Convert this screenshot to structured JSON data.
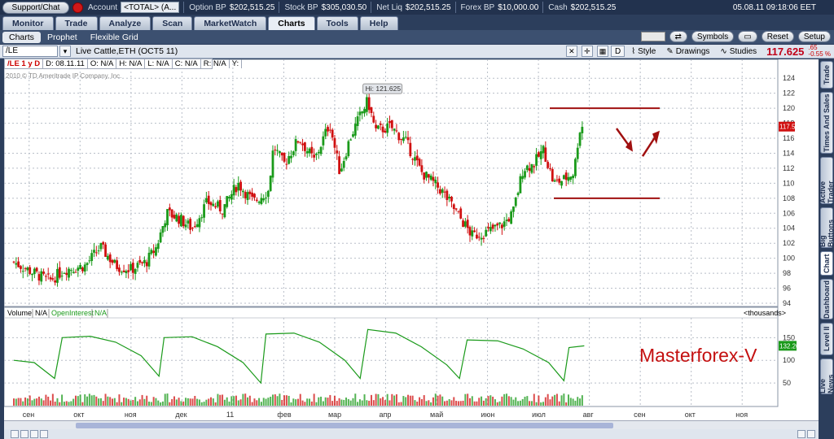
{
  "topbar": {
    "support_label": "Support/Chat",
    "account_label": "Account",
    "account_value": "<TOTAL> (A...",
    "option_bp_label": "Option BP",
    "option_bp_value": "$202,515.25",
    "stock_bp_label": "Stock BP",
    "stock_bp_value": "$305,030.50",
    "net_liq_label": "Net Liq",
    "net_liq_value": "$202,515.25",
    "forex_bp_label": "Forex BP",
    "forex_bp_value": "$10,000.00",
    "cash_label": "Cash",
    "cash_value": "$202,515.25",
    "clock": "05.08.11 09:18:06 EET"
  },
  "main_tabs": [
    "Monitor",
    "Trade",
    "Analyze",
    "Scan",
    "MarketWatch",
    "Charts",
    "Tools",
    "Help"
  ],
  "active_main_tab": "Charts",
  "sub_tabs": [
    "Charts",
    "Prophet",
    "Flexible Grid"
  ],
  "subnav_buttons": {
    "symbols": "Symbols",
    "reset": "Reset",
    "setup": "Setup"
  },
  "symbol_bar": {
    "symbol": "/LE",
    "description": "Live Cattle,ETH (OCT5 11)",
    "period": "D",
    "style": "Style",
    "drawings": "Drawings",
    "studies": "Studies",
    "last_price": "117.625",
    "change": ".65",
    "change_pct": "-0.55 %"
  },
  "info_bar": [
    "/LE 1 y D",
    "D: 08.11.11",
    "O: N/A",
    "H: N/A",
    "L: N/A",
    "C: N/A",
    "R: N/A",
    "Y:"
  ],
  "copyright": "2010 © TD Ameritrade IP Company, Inc.",
  "hi_label": "Hi: 121.625",
  "price_label": "117.55",
  "volume_label": "Volume",
  "na1": "N/A",
  "oi_label": "OpenInterest",
  "na2": "N/A",
  "thousands": "<thousands>",
  "vol_badge": "132.26",
  "watermark": "Masterforex-V",
  "price_axis": [
    "124",
    "122",
    "120",
    "118",
    "116",
    "114",
    "112",
    "110",
    "108",
    "106",
    "104",
    "102",
    "100",
    "98",
    "96",
    "94"
  ],
  "volume_axis": [
    "150",
    "100",
    "50"
  ],
  "x_labels": [
    "сен",
    "окт",
    "ноя",
    "дек",
    "11",
    "фев",
    "мар",
    "апр",
    "май",
    "июн",
    "июл",
    "авг",
    "сен",
    "окт",
    "ноя"
  ],
  "side_tabs": [
    "Trade",
    "Times And Sales",
    "Active Trader",
    "Big Buttons",
    "Chart",
    "Dashboard",
    "Level II",
    "Live News"
  ],
  "colors": {
    "up": "#1a9a1a",
    "down": "#d01010",
    "oi_line": "#1a9a1a",
    "annotation": "#a01010",
    "accent": "#c00018"
  },
  "chart_data": {
    "type": "candlestick",
    "title": "Live Cattle,ETH (OCT5 11)",
    "ylim": [
      94,
      125
    ],
    "x_categories": [
      "сен",
      "окт",
      "ноя",
      "дек",
      "11",
      "фев",
      "мар",
      "апр",
      "май",
      "июн",
      "июл",
      "авг",
      "сен",
      "окт",
      "ноя"
    ],
    "close_path": [
      {
        "x": 0.0,
        "y": 99.5
      },
      {
        "x": 0.4,
        "y": 98.0
      },
      {
        "x": 0.7,
        "y": 97.0
      },
      {
        "x": 1.0,
        "y": 98.5
      },
      {
        "x": 1.4,
        "y": 99.0
      },
      {
        "x": 1.7,
        "y": 101.5
      },
      {
        "x": 2.0,
        "y": 99.0
      },
      {
        "x": 2.3,
        "y": 98.5
      },
      {
        "x": 2.6,
        "y": 99.5
      },
      {
        "x": 2.8,
        "y": 101.5
      },
      {
        "x": 3.0,
        "y": 106.0
      },
      {
        "x": 3.2,
        "y": 105.5
      },
      {
        "x": 3.5,
        "y": 104.0
      },
      {
        "x": 3.8,
        "y": 107.5
      },
      {
        "x": 4.1,
        "y": 106.5
      },
      {
        "x": 4.4,
        "y": 110.0
      },
      {
        "x": 4.7,
        "y": 107.5
      },
      {
        "x": 5.0,
        "y": 109.0
      },
      {
        "x": 5.1,
        "y": 115.0
      },
      {
        "x": 5.3,
        "y": 112.5
      },
      {
        "x": 5.6,
        "y": 116.0
      },
      {
        "x": 5.9,
        "y": 113.0
      },
      {
        "x": 6.2,
        "y": 118.0
      },
      {
        "x": 6.4,
        "y": 111.5
      },
      {
        "x": 6.6,
        "y": 116.0
      },
      {
        "x": 6.8,
        "y": 119.0
      },
      {
        "x": 6.95,
        "y": 121.0
      },
      {
        "x": 7.1,
        "y": 117.0
      },
      {
        "x": 7.4,
        "y": 117.5
      },
      {
        "x": 7.7,
        "y": 115.5
      },
      {
        "x": 8.0,
        "y": 111.5
      },
      {
        "x": 8.4,
        "y": 109.0
      },
      {
        "x": 8.7,
        "y": 106.0
      },
      {
        "x": 9.0,
        "y": 103.0
      },
      {
        "x": 9.3,
        "y": 103.5
      },
      {
        "x": 9.6,
        "y": 104.5
      },
      {
        "x": 9.8,
        "y": 106.0
      },
      {
        "x": 10.0,
        "y": 112.0
      },
      {
        "x": 10.2,
        "y": 112.5
      },
      {
        "x": 10.4,
        "y": 114.5
      },
      {
        "x": 10.6,
        "y": 110.0
      },
      {
        "x": 10.8,
        "y": 110.5
      },
      {
        "x": 11.0,
        "y": 111.5
      },
      {
        "x": 11.1,
        "y": 117.0
      },
      {
        "x": 11.2,
        "y": 118.0
      }
    ],
    "high": 121.625,
    "last": 117.55,
    "annotations": {
      "upper_level": 120.0,
      "lower_level": 108.0
    },
    "open_interest": {
      "ylim": [
        0,
        190
      ],
      "points": [
        {
          "x": 0.0,
          "y": 100
        },
        {
          "x": 0.4,
          "y": 95
        },
        {
          "x": 0.8,
          "y": 60
        },
        {
          "x": 0.95,
          "y": 150
        },
        {
          "x": 1.5,
          "y": 153
        },
        {
          "x": 2.0,
          "y": 140
        },
        {
          "x": 2.5,
          "y": 110
        },
        {
          "x": 2.85,
          "y": 65
        },
        {
          "x": 2.95,
          "y": 150
        },
        {
          "x": 3.5,
          "y": 152
        },
        {
          "x": 4.0,
          "y": 130
        },
        {
          "x": 4.5,
          "y": 95
        },
        {
          "x": 4.85,
          "y": 50
        },
        {
          "x": 4.95,
          "y": 158
        },
        {
          "x": 5.5,
          "y": 160
        },
        {
          "x": 6.0,
          "y": 140
        },
        {
          "x": 6.5,
          "y": 100
        },
        {
          "x": 6.8,
          "y": 60
        },
        {
          "x": 6.95,
          "y": 168
        },
        {
          "x": 7.5,
          "y": 160
        },
        {
          "x": 8.0,
          "y": 130
        },
        {
          "x": 8.5,
          "y": 90
        },
        {
          "x": 8.75,
          "y": 60
        },
        {
          "x": 8.9,
          "y": 145
        },
        {
          "x": 9.5,
          "y": 143
        },
        {
          "x": 10.0,
          "y": 125
        },
        {
          "x": 10.5,
          "y": 95
        },
        {
          "x": 10.8,
          "y": 55
        },
        {
          "x": 10.9,
          "y": 128
        },
        {
          "x": 11.2,
          "y": 132
        }
      ]
    }
  }
}
